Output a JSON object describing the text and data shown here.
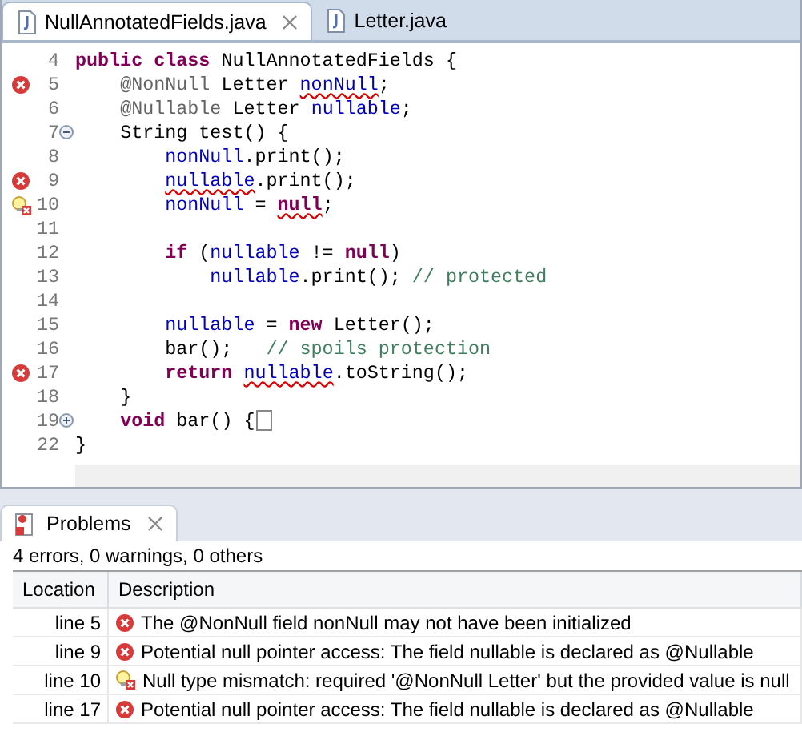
{
  "editor_tabs": [
    {
      "label": "NullAnnotatedFields.java",
      "selected": true,
      "closable": true
    },
    {
      "label": "Letter.java",
      "selected": false
    }
  ],
  "code_lines": [
    {
      "number": "4",
      "tokens": [
        {
          "t": "public class",
          "kind": "kw"
        },
        {
          "t": " NullAnnotatedFields {",
          "kind": "plain"
        }
      ]
    },
    {
      "number": "5",
      "marker": {
        "kind": "error"
      },
      "tokens": [
        {
          "t": "    @NonNull",
          "kind": "ann"
        },
        {
          "t": " Letter ",
          "kind": "plain"
        },
        {
          "t": "nonNull",
          "kind": "field",
          "err": true
        },
        {
          "t": ";",
          "kind": "plain"
        }
      ]
    },
    {
      "number": "6",
      "tokens": [
        {
          "t": "    @Nullable",
          "kind": "ann"
        },
        {
          "t": " Letter ",
          "kind": "plain"
        },
        {
          "t": "nullable",
          "kind": "field"
        },
        {
          "t": ";",
          "kind": "plain"
        }
      ]
    },
    {
      "number": "7",
      "fold": {
        "kind": "collapse"
      },
      "tokens": [
        {
          "t": "    String test() {",
          "kind": "plain"
        }
      ]
    },
    {
      "number": "8",
      "tokens": [
        {
          "t": "        nonNull",
          "kind": "field"
        },
        {
          "t": ".print();",
          "kind": "plain"
        }
      ]
    },
    {
      "number": "9",
      "marker": {
        "kind": "error"
      },
      "tokens": [
        {
          "t": "        nullable",
          "kind": "field",
          "err": true
        },
        {
          "t": ".print();",
          "kind": "plain"
        }
      ]
    },
    {
      "number": "10",
      "marker": {
        "kind": "quickfix"
      },
      "tokens": [
        {
          "t": "        nonNull",
          "kind": "field"
        },
        {
          "t": " = ",
          "kind": "plain"
        },
        {
          "t": "null",
          "kind": "kw",
          "err": true
        },
        {
          "t": ";",
          "kind": "plain"
        }
      ]
    },
    {
      "number": "11"
    },
    {
      "number": "12",
      "tokens": [
        {
          "t": "        if",
          "kind": "kw"
        },
        {
          "t": " (",
          "kind": "plain"
        },
        {
          "t": "nullable",
          "kind": "field"
        },
        {
          "t": " != ",
          "kind": "plain"
        },
        {
          "t": "null",
          "kind": "kw"
        },
        {
          "t": ")",
          "kind": "plain"
        }
      ]
    },
    {
      "number": "13",
      "tokens": [
        {
          "t": "            nullable",
          "kind": "field"
        },
        {
          "t": ".print(); ",
          "kind": "plain"
        },
        {
          "t": "// protected",
          "kind": "comment"
        }
      ]
    },
    {
      "number": "14"
    },
    {
      "number": "15",
      "tokens": [
        {
          "t": "        nullable",
          "kind": "field"
        },
        {
          "t": " = ",
          "kind": "plain"
        },
        {
          "t": "new",
          "kind": "kw"
        },
        {
          "t": " Letter();",
          "kind": "plain"
        }
      ]
    },
    {
      "number": "16",
      "tokens": [
        {
          "t": "        bar();   ",
          "kind": "plain"
        },
        {
          "t": "// spoils protection",
          "kind": "comment"
        }
      ]
    },
    {
      "number": "17",
      "marker": {
        "kind": "error"
      },
      "tokens": [
        {
          "t": "        return ",
          "kind": "kw"
        },
        {
          "t": "nullable",
          "kind": "field",
          "err": true
        },
        {
          "t": ".toString();",
          "kind": "plain"
        }
      ]
    },
    {
      "number": "18",
      "tokens": [
        {
          "t": "    }",
          "kind": "plain"
        }
      ]
    },
    {
      "number": "19",
      "fold": {
        "kind": "expand"
      },
      "folded": true,
      "tokens": [
        {
          "t": "    void",
          "kind": "kw"
        },
        {
          "t": " bar() {",
          "kind": "plain"
        }
      ]
    },
    {
      "number": "22",
      "tokens": [
        {
          "t": "}",
          "kind": "plain"
        }
      ]
    }
  ],
  "problems_view": {
    "tab": {
      "label": "Problems",
      "selected": true
    },
    "summary": "4 errors, 0 warnings, 0 others",
    "columns": [
      "Location",
      "Description"
    ],
    "rows": [
      {
        "location": "line 5",
        "kind": "error",
        "description": "The @NonNull field nonNull may not have been initialized"
      },
      {
        "location": "line 9",
        "kind": "error",
        "description": "Potential null pointer access: The field nullable is declared as @Nullable"
      },
      {
        "location": "line 10",
        "kind": "quickfix",
        "description": "Null type mismatch: required '@NonNull Letter' but the provided value is null"
      },
      {
        "location": "line 17",
        "kind": "error",
        "description": "Potential null pointer access: The field nullable is declared as @Nullable"
      }
    ]
  }
}
